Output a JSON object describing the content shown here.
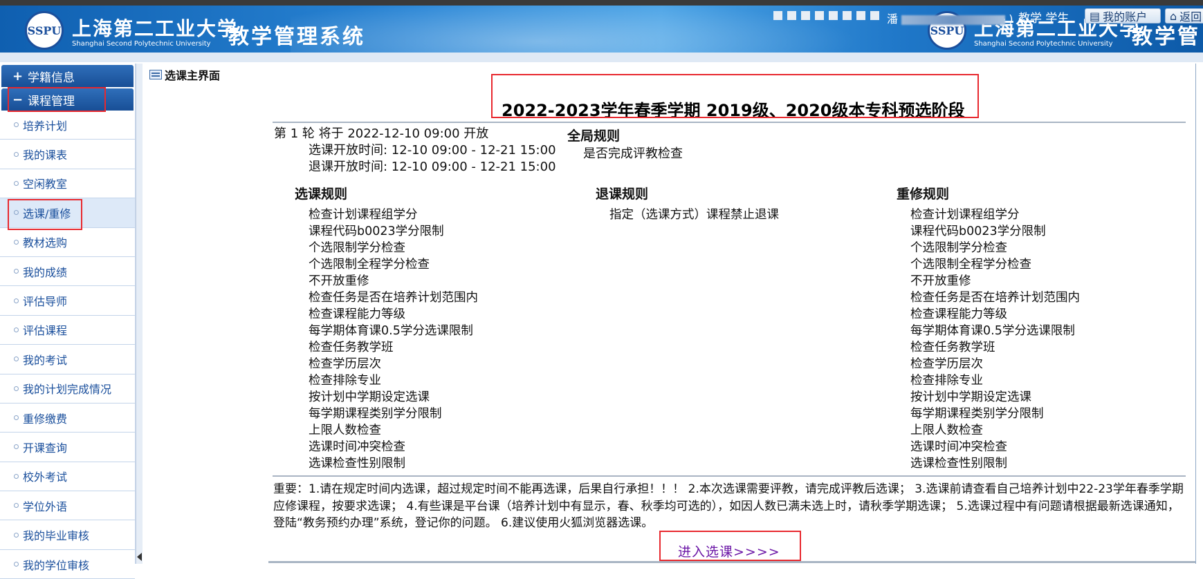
{
  "header": {
    "logo_text": "SSPU",
    "university_cn": "上海第二工业大学",
    "university_en": "Shanghai Second Polytechnic University",
    "system_title": "教学管理系统",
    "system_title_partial": "教学管",
    "user_prefix": "潘",
    "user_suffix": ")",
    "role": "教学  学生",
    "account_button": "我的账户",
    "back_button": "返回"
  },
  "sidebar": {
    "group_student_record": "学籍信息",
    "group_course_mgmt": "课程管理",
    "items": [
      {
        "label": "培养计划"
      },
      {
        "label": "我的课表"
      },
      {
        "label": "空闲教室"
      },
      {
        "label": "选课/重修"
      },
      {
        "label": "教材选购"
      },
      {
        "label": "我的成绩"
      },
      {
        "label": "评估导师"
      },
      {
        "label": "评估课程"
      },
      {
        "label": "我的考试"
      },
      {
        "label": "我的计划完成情况"
      },
      {
        "label": "重修缴费"
      },
      {
        "label": "开课查询"
      },
      {
        "label": "校外考试"
      },
      {
        "label": "学位外语"
      },
      {
        "label": "我的毕业审核"
      },
      {
        "label": "我的学位审核"
      }
    ]
  },
  "main": {
    "breadcrumb": "选课主界面",
    "phase_title": "2022-2023学年春季学期 2019级、2020级本专科预选阶段",
    "round_line": "第 1 轮 将于 2022-12-10 09:00 开放",
    "select_open_time": "选课开放时间: 12-10 09:00 - 12-21 15:00",
    "drop_open_time": "退课开放时间: 12-10 09:00 - 12-21 15:00",
    "global_rules_title": "全局规则",
    "global_rules": [
      "是否完成评教检查"
    ],
    "select_rules_title": "选课规则",
    "select_rules": [
      "检查计划课程组学分",
      "课程代码b0023学分限制",
      "个选限制学分检查",
      "个选限制全程学分检查",
      "不开放重修",
      "检查任务是否在培养计划范围内",
      "检查课程能力等级",
      "每学期体育课0.5学分选课限制",
      "检查任务教学班",
      "检查学历层次",
      "检查排除专业",
      "按计划中学期设定选课",
      "每学期课程类别学分限制",
      "上限人数检查",
      "选课时间冲突检查",
      "选课检查性别限制"
    ],
    "drop_rules_title": "退课规则",
    "drop_rules": [
      "指定（选课方式）课程禁止退课"
    ],
    "retake_rules_title": "重修规则",
    "retake_rules": [
      "检查计划课程组学分",
      "课程代码b0023学分限制",
      "个选限制学分检查",
      "个选限制全程学分检查",
      "不开放重修",
      "检查任务是否在培养计划范围内",
      "检查课程能力等级",
      "每学期体育课0.5学分选课限制",
      "检查任务教学班",
      "检查学历层次",
      "检查排除专业",
      "按计划中学期设定选课",
      "每学期课程类别学分限制",
      "上限人数检查",
      "选课时间冲突检查",
      "选课检查性别限制"
    ],
    "notice": "重要：1.请在规定时间内选课，超过规定时间不能再选课，后果自行承担！！！ 2.本次选课需要评教，请完成评教后选课； 3.选课前请查看自己培养计划中22-23学年春季学期应修课程，按要求选课； 4.有些课是平台课（培养计划中有显示，春、秋季均可选的），如因人数已满未选上时，请秋季学期选课； 5.选课过程中有问题请根据最新选课通知，登陆“教务预约办理”系统，登记你的问题。 6.建议使用火狐浏览器选课。",
    "enter_link": "进入选课>>>>"
  },
  "colors": {
    "header_blue": "#1f77c8",
    "sidebar_head": "#184f96",
    "link_purple": "#6b16a6",
    "highlight_red": "#e8282e"
  }
}
